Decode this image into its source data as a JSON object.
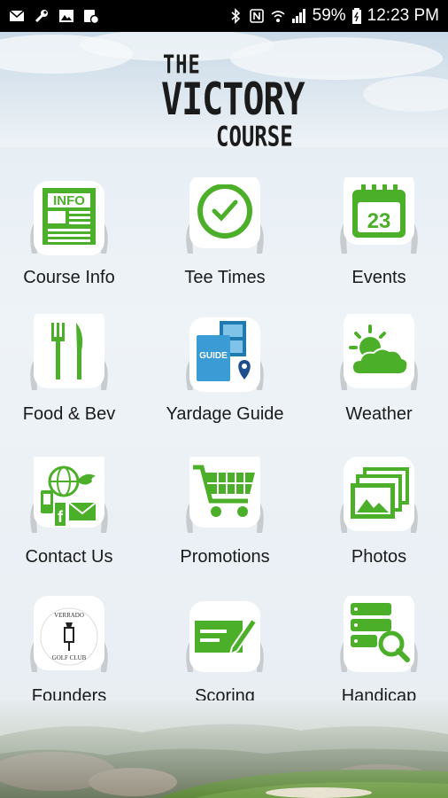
{
  "status_bar": {
    "battery": "59%",
    "time": "12:23 PM",
    "left_icons": [
      "mail-icon",
      "wrench-icon",
      "image-icon",
      "sync-icon"
    ],
    "right_icons": [
      "bluetooth-icon",
      "nfc-icon",
      "wifi-icon",
      "signal-icon",
      "battery-icon"
    ]
  },
  "logo": {
    "line1": "THE",
    "line2": "VICTORY",
    "line3": "COURSE"
  },
  "tiles": [
    {
      "label": "Course Info",
      "icon": "info-newspaper-icon"
    },
    {
      "label": "Tee Times",
      "icon": "clock-icon"
    },
    {
      "label": "Events",
      "icon": "calendar-icon",
      "badge": "23"
    },
    {
      "label": "Food & Bev",
      "icon": "fork-knife-icon"
    },
    {
      "label": "Yardage Guide",
      "icon": "guide-map-icon",
      "badge": "GUIDE"
    },
    {
      "label": "Weather",
      "icon": "sun-cloud-icon"
    },
    {
      "label": "Contact Us",
      "icon": "contact-globe-icon"
    },
    {
      "label": "Promotions",
      "icon": "shopping-cart-icon"
    },
    {
      "label": "Photos",
      "icon": "photos-icon"
    },
    {
      "label": "Founders",
      "icon": "club-crest-icon",
      "badge_top": "VERRADO",
      "badge_bottom": "GOLF CLUB"
    },
    {
      "label": "Scoring",
      "icon": "scorecard-pencil-icon"
    },
    {
      "label": "Handicap",
      "icon": "database-search-icon"
    }
  ],
  "colors": {
    "green": "#4caf2a",
    "dark": "#1a1a1a",
    "status_bar": "#000000"
  }
}
